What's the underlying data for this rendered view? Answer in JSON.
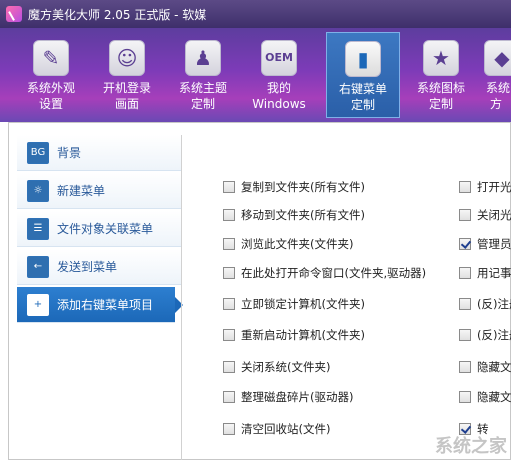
{
  "window": {
    "title": "魔方美化大师 2.05 正式版 - 软媒"
  },
  "toolbar": {
    "items": [
      {
        "label1": "系统外观",
        "label2": "设置",
        "icon": "brush-icon",
        "glyph": "✎"
      },
      {
        "label1": "开机登录",
        "label2": "画面",
        "icon": "user-icon",
        "glyph": "☺"
      },
      {
        "label1": "系统主题",
        "label2": "定制",
        "icon": "shirt-icon",
        "glyph": "♟"
      },
      {
        "label1": "我的",
        "label2": "Windows",
        "icon": "oem-icon",
        "glyph": "OEM"
      },
      {
        "label1": "右键菜单",
        "label2": "定制",
        "icon": "context-menu-icon",
        "glyph": "▮",
        "active": true
      },
      {
        "label1": "系统图标",
        "label2": "定制",
        "icon": "star-icon",
        "glyph": "★"
      },
      {
        "label1": "系统",
        "label2": "方",
        "icon": "misc-icon",
        "glyph": "◆"
      }
    ]
  },
  "sidebar": {
    "items": [
      {
        "label": "背景",
        "badge": "BG"
      },
      {
        "label": "新建菜单",
        "badge": "☼"
      },
      {
        "label": "文件对象关联菜单",
        "badge": "☰"
      },
      {
        "label": "发送到菜单",
        "badge": "←"
      },
      {
        "label": "添加右键菜单项目",
        "badge": "+",
        "active": true
      }
    ]
  },
  "options_left": [
    {
      "label": "复制到文件夹(所有文件)",
      "checked": false
    },
    {
      "label": "移动到文件夹(所有文件)",
      "checked": false
    },
    {
      "label": "浏览此文件夹(文件夹)",
      "checked": false
    },
    {
      "label": "在此处打开命令窗口(文件夹,驱动器)",
      "checked": false
    },
    {
      "label": "立即锁定计算机(文件夹)",
      "checked": false
    },
    {
      "label": "重新启动计算机(文件夹)",
      "checked": false
    },
    {
      "label": "关闭系统(文件夹)",
      "checked": false
    },
    {
      "label": "整理磁盘碎片(驱动器)",
      "checked": false
    },
    {
      "label": "清空回收站(文件)",
      "checked": false
    }
  ],
  "options_right": [
    {
      "label": "打开光",
      "checked": false
    },
    {
      "label": "关闭光",
      "checked": false
    },
    {
      "label": "管理员",
      "checked": true
    },
    {
      "label": "用记事",
      "checked": false
    },
    {
      "label": "(反)注册",
      "checked": false
    },
    {
      "label": "(反)注册",
      "checked": false
    },
    {
      "label": "隐藏文",
      "checked": false
    },
    {
      "label": "隐藏文",
      "checked": false
    },
    {
      "label": "转",
      "checked": true
    }
  ],
  "watermark": "系统之家"
}
